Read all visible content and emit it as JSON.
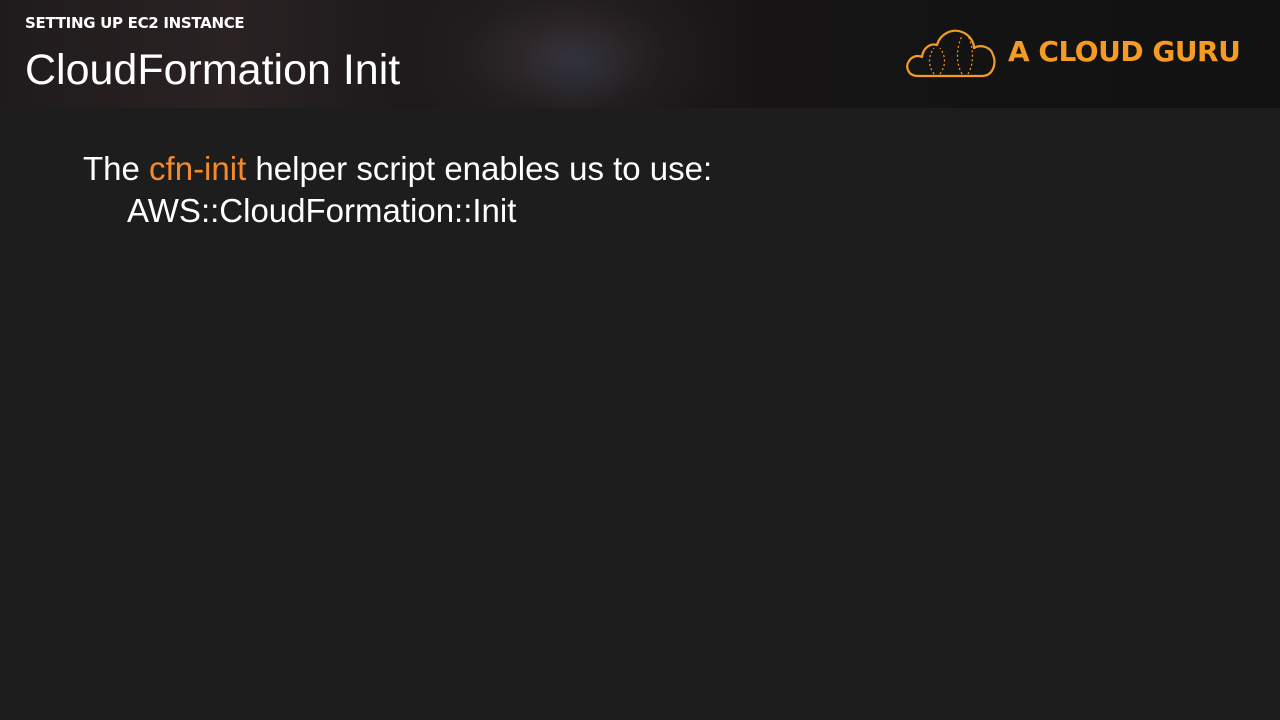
{
  "header": {
    "section_label": "SETTING UP EC2 INSTANCE",
    "title": "CloudFormation Init"
  },
  "logo": {
    "text": "A CLOUD GURU",
    "icon": "cloud-icon",
    "color": "#f59a23"
  },
  "body": {
    "line1_prefix": "The ",
    "line1_highlight": "cfn-init",
    "line1_suffix": " helper script enables us to use:",
    "line2": "AWS::CloudFormation::Init",
    "highlight_color": "#f58a2c"
  }
}
